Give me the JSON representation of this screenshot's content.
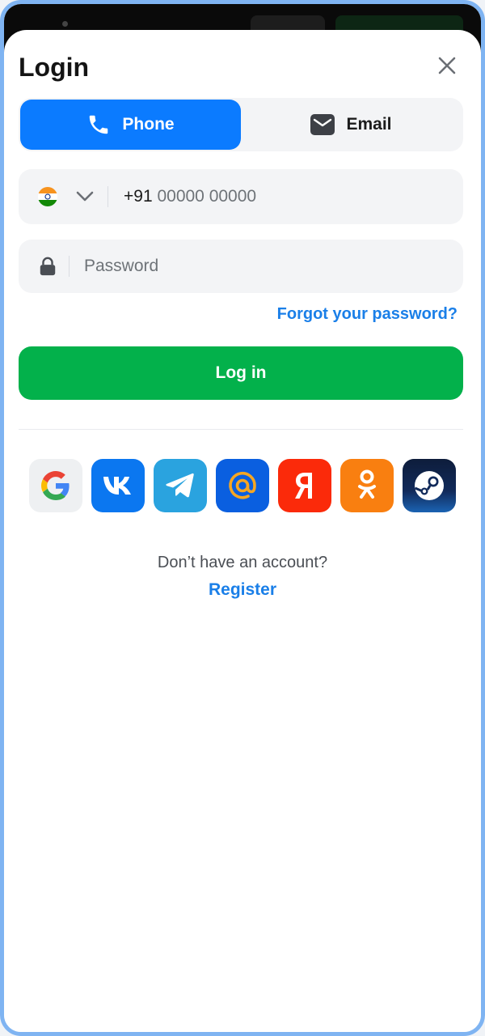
{
  "header": {
    "title": "Login"
  },
  "tabs": [
    {
      "label": "Phone",
      "icon": "phone-icon",
      "active": true
    },
    {
      "label": "Email",
      "icon": "mail-icon",
      "active": false
    }
  ],
  "phone": {
    "country_icon": "india-flag-icon",
    "country_code": "+91",
    "placeholder": "00000 00000"
  },
  "password": {
    "placeholder": "Password"
  },
  "links": {
    "forgot": "Forgot your password?"
  },
  "buttons": {
    "login": "Log in"
  },
  "socials": [
    {
      "name": "google",
      "icon": "google-icon",
      "color": "#eef0f2"
    },
    {
      "name": "vk",
      "icon": "vk-icon",
      "color": "#0b77f0"
    },
    {
      "name": "telegram",
      "icon": "telegram-icon",
      "color": "#2aa3df"
    },
    {
      "name": "mail",
      "icon": "mail-ru-icon",
      "color": "#0a5fe0"
    },
    {
      "name": "yandex",
      "icon": "yandex-icon",
      "color": "#fb2a0a"
    },
    {
      "name": "odnoklassniki",
      "icon": "ok-icon",
      "color": "#f97f10"
    },
    {
      "name": "steam",
      "icon": "steam-icon",
      "color": "#112a5a"
    }
  ],
  "footer": {
    "question": "Don’t have an account?",
    "register": "Register"
  },
  "colors": {
    "accent_blue": "#0b7bff",
    "link_blue": "#1a7fe8",
    "login_green": "#03b14b",
    "field_bg": "#f3f4f6",
    "frame_border": "#7fb4f2"
  }
}
